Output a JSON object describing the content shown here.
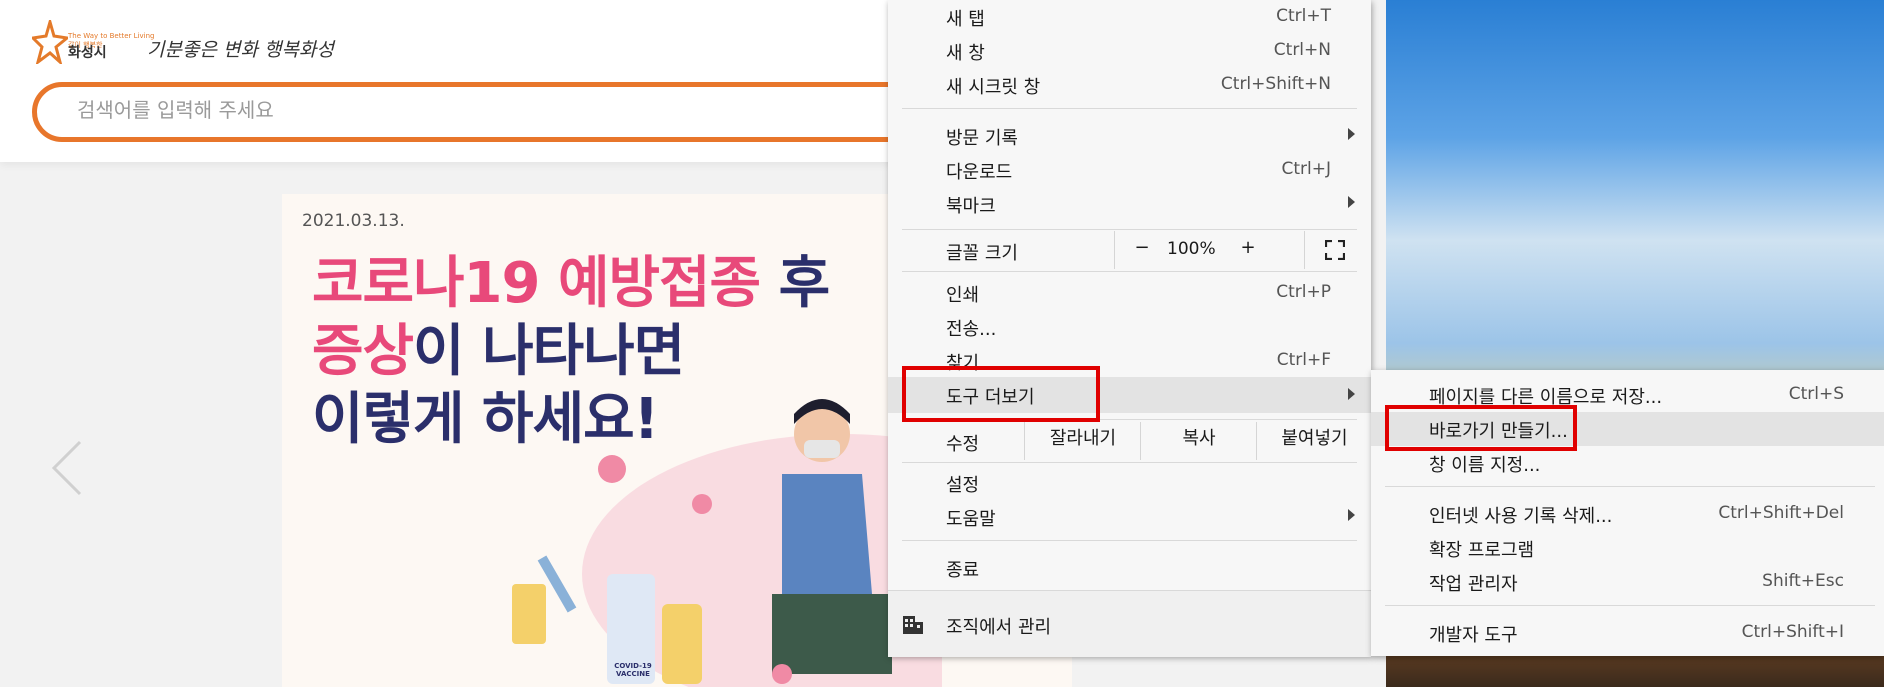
{
  "site": {
    "logo_small": "The Way to Better Living\n같이 행복한",
    "logo_city": "화성시",
    "logo_slogan": "기분좋은 변화 행복화성",
    "search_placeholder": "검색어를 입력해 주세요",
    "banner": {
      "date": "2021.03.13.",
      "title_line1_pink": "코로나19 예방접종",
      "title_line1_dark": " 후",
      "title_line2_pink": "증상",
      "title_line2_dark": "이 나타나면",
      "title_line3": "이렇게 하세요!",
      "vaccine_label": "COVID-19 VACCINE"
    }
  },
  "menu": {
    "new_tab": {
      "label": "새 탭",
      "shortcut": "Ctrl+T"
    },
    "new_window": {
      "label": "새 창",
      "shortcut": "Ctrl+N"
    },
    "incognito": {
      "label": "새 시크릿 창",
      "shortcut": "Ctrl+Shift+N"
    },
    "history": {
      "label": "방문 기록"
    },
    "downloads": {
      "label": "다운로드",
      "shortcut": "Ctrl+J"
    },
    "bookmarks": {
      "label": "북마크"
    },
    "zoom": {
      "label": "글꼴 크기",
      "minus": "−",
      "value": "100%",
      "plus": "+"
    },
    "print": {
      "label": "인쇄",
      "shortcut": "Ctrl+P"
    },
    "cast": {
      "label": "전송..."
    },
    "find": {
      "label": "찾기...",
      "shortcut": "Ctrl+F"
    },
    "more_tools": {
      "label": "도구 더보기"
    },
    "edit": {
      "label": "수정",
      "cut": "잘라내기",
      "copy": "복사",
      "paste": "붙여넣기"
    },
    "settings": {
      "label": "설정"
    },
    "help": {
      "label": "도움말"
    },
    "exit": {
      "label": "종료"
    },
    "managed": {
      "label": "조직에서 관리"
    }
  },
  "submenu": {
    "save_page": {
      "label": "페이지를 다른 이름으로 저장...",
      "shortcut": "Ctrl+S"
    },
    "create_shortcut": {
      "label": "바로가기 만들기..."
    },
    "name_window": {
      "label": "창 이름 지정..."
    },
    "clear_data": {
      "label": "인터넷 사용 기록 삭제...",
      "shortcut": "Ctrl+Shift+Del"
    },
    "extensions": {
      "label": "확장 프로그램"
    },
    "task_manager": {
      "label": "작업 관리자",
      "shortcut": "Shift+Esc"
    },
    "devtools": {
      "label": "개발자 도구",
      "shortcut": "Ctrl+Shift+I"
    }
  },
  "colors": {
    "accent_orange": "#e8762b",
    "highlight_red": "#e00000",
    "banner_pink": "#e8497a",
    "banner_navy": "#2b2f6b"
  }
}
